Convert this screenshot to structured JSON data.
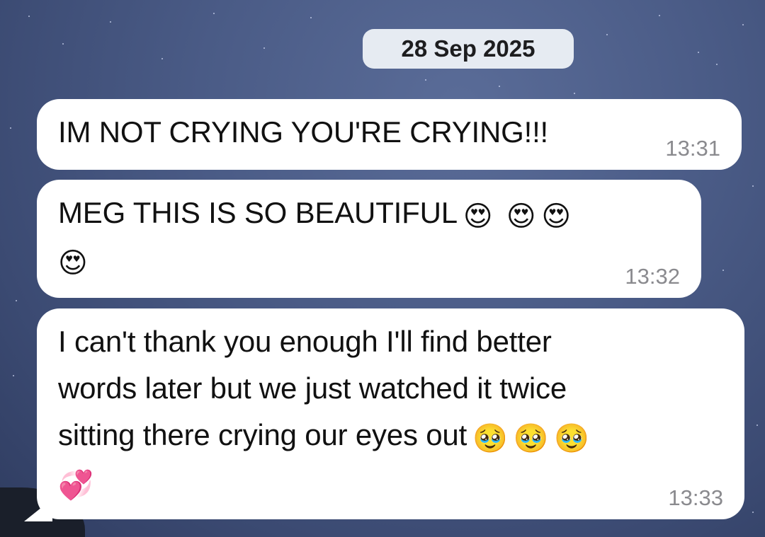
{
  "chat": {
    "date_separator": "28 Sep 2025",
    "messages": [
      {
        "text": "IM NOT CRYING YOU'RE CRYING!!!",
        "emojis": [],
        "time": "13:31"
      },
      {
        "text": "MEG THIS IS SO BEAUTIFUL",
        "emojis": [
          "😍",
          "😍",
          "😍",
          "😍"
        ],
        "time": "13:32"
      },
      {
        "text": "I can't thank you enough I'll find better\nwords later but we just watched it twice\nsitting there crying our eyes out",
        "emojis": [
          "🥹",
          "🥹",
          "🥹",
          "💞"
        ],
        "time": "13:33"
      }
    ]
  }
}
